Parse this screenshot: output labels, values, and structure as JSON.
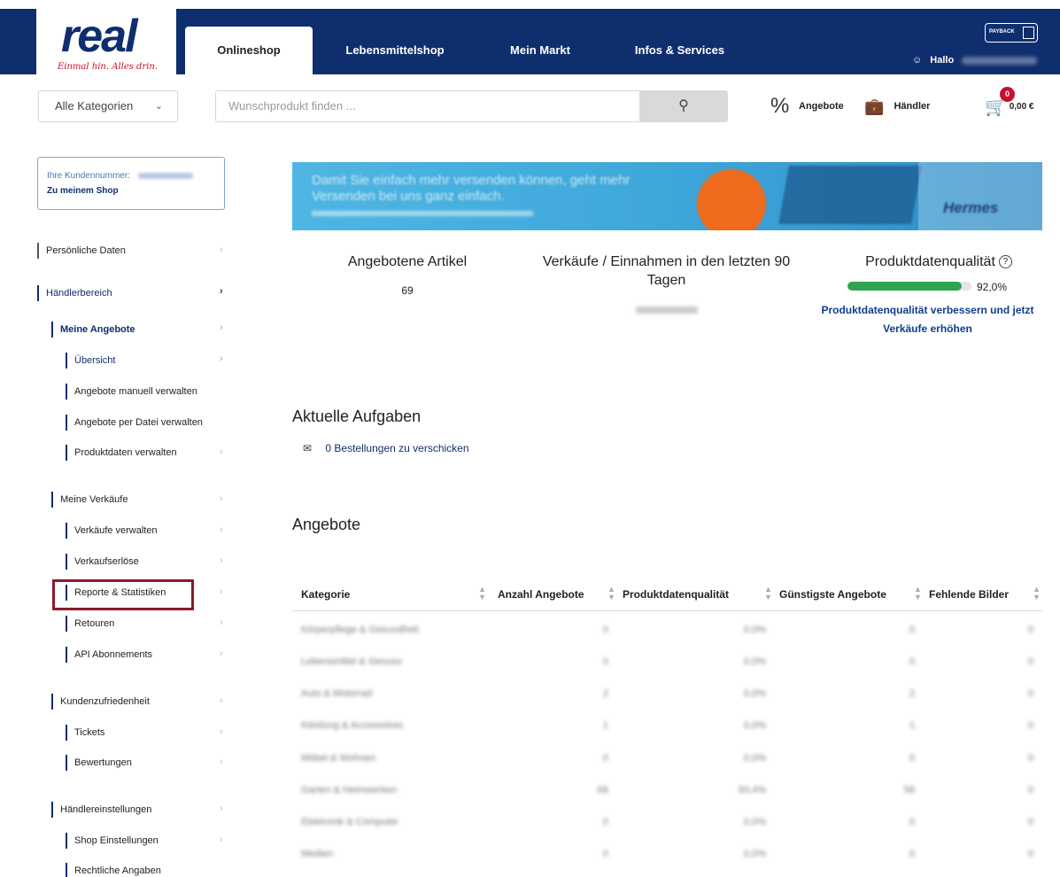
{
  "header": {
    "logo_text": "real",
    "logo_tagline": "Einmal hin. Alles drin.",
    "tabs": [
      {
        "label": "Onlineshop",
        "active": true
      },
      {
        "label": "Lebensmittelshop",
        "active": false
      },
      {
        "label": "Mein Markt",
        "active": false
      },
      {
        "label": "Infos & Services",
        "active": false
      }
    ],
    "payback_label": "PAYBACK",
    "greeting": "Hallo",
    "accent_color": "#0f2e6e"
  },
  "searchbar": {
    "category_label": "Alle Kategorien",
    "search_placeholder": "Wunschprodukt finden ...",
    "offers_label": "Angebote",
    "dealer_label": "Händler",
    "cart_count": "0",
    "cart_total": "0,00 €"
  },
  "sidebar": {
    "customer_label": "Ihre Kundennummer:",
    "shop_link": "Zu meinem Shop",
    "items": [
      {
        "label": "Persönliche Daten"
      },
      {
        "label": "Händlerbereich"
      },
      {
        "label": "Meine Angebote"
      },
      {
        "label": "Übersicht"
      },
      {
        "label": "Angebote manuell verwalten"
      },
      {
        "label": "Angebote per Datei verwalten"
      },
      {
        "label": "Produktdaten verwalten"
      },
      {
        "label": "Meine Verkäufe"
      },
      {
        "label": "Verkäufe verwalten"
      },
      {
        "label": "Verkaufserlöse"
      },
      {
        "label": "Reporte & Statistiken"
      },
      {
        "label": "Retouren"
      },
      {
        "label": "API Abonnements"
      },
      {
        "label": "Kundenzufriedenheit"
      },
      {
        "label": "Tickets"
      },
      {
        "label": "Bewertungen"
      },
      {
        "label": "Händlereinstellungen"
      },
      {
        "label": "Shop Einstellungen"
      },
      {
        "label": "Rechtliche Angaben"
      }
    ]
  },
  "banner": {
    "text": "Damit Sie einfach mehr versenden können, geht mehr Versenden bei uns ganz einfach.",
    "brand": "Hermes"
  },
  "stats": {
    "offered_title": "Angebotene Artikel",
    "offered_value": "69",
    "sales_title": "Verkäufe / Einnahmen in den letzten 90 Tagen",
    "quality_title": "Produktdatenqualität",
    "quality_percent": 92.0,
    "quality_value": "92,0%",
    "quality_link": "Produktdatenqualität verbessern und jetzt Verkäufe erhöhen",
    "quality_color": "#2ea44f"
  },
  "tasks": {
    "title": "Aktuelle Aufgaben",
    "items": [
      "0 Bestellungen zu verschicken"
    ]
  },
  "offers": {
    "title": "Angebote",
    "columns": [
      "Kategorie",
      "Anzahl Angebote",
      "Produktdatenqualität",
      "Günstigste Angebote",
      "Fehlende Bilder"
    ],
    "rows": [
      [
        "Körperpflege & Gesundheit",
        "0",
        "0,0%",
        "0",
        "0"
      ],
      [
        "Lebensmittel & Genuss",
        "0",
        "0,0%",
        "0",
        "0"
      ],
      [
        "Auto & Motorrad",
        "2",
        "0,0%",
        "2",
        "0"
      ],
      [
        "Kleidung & Accessoires",
        "1",
        "0,0%",
        "1",
        "0"
      ],
      [
        "Möbel & Wohnen",
        "0",
        "0,0%",
        "0",
        "0"
      ],
      [
        "Garten & Heimwerken",
        "68",
        "93,4%",
        "58",
        "0"
      ],
      [
        "Elektronik & Computer",
        "0",
        "0,0%",
        "0",
        "0"
      ],
      [
        "Medien",
        "0",
        "0,0%",
        "0",
        "0"
      ]
    ]
  }
}
